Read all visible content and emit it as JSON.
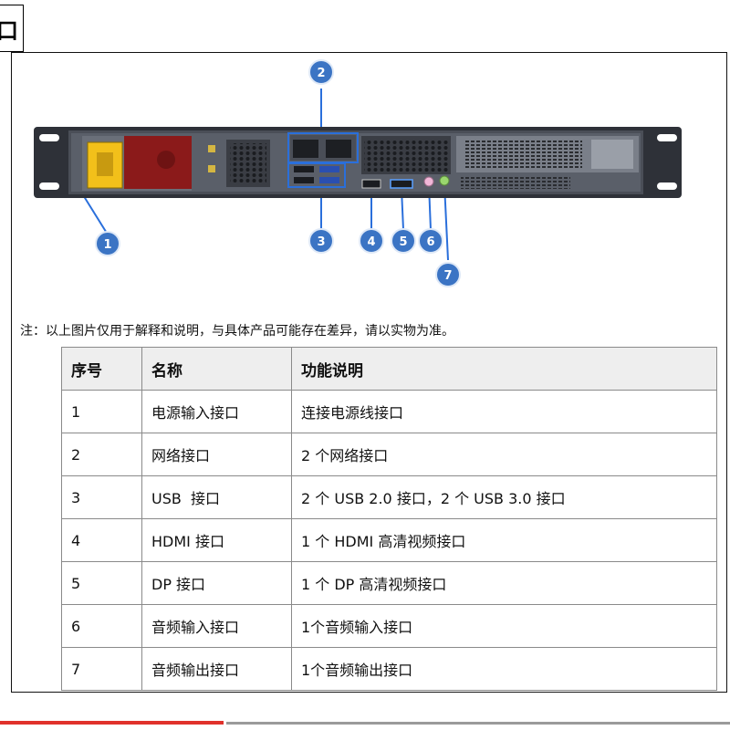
{
  "header": {
    "title_char": "口"
  },
  "figure": {
    "callouts": [
      "1",
      "2",
      "3",
      "4",
      "5",
      "6",
      "7"
    ],
    "colors": {
      "callout_fill": "#3b74c4",
      "power_socket": "#f2c01a",
      "power_module": "#8b1a1a",
      "highlight_box": "#2a6fdb",
      "chassis": "#4a4e57"
    }
  },
  "note": "注：以上图片仅用于解释和说明，与具体产品可能存在差异，请以实物为准。",
  "table": {
    "headers": [
      "序号",
      "名称",
      "功能说明"
    ],
    "rows": [
      [
        "1",
        "电源输入接口",
        "连接电源线接口"
      ],
      [
        "2",
        "网络接口",
        "2 个网络接口"
      ],
      [
        "3",
        "USB  接口",
        "2 个 USB 2.0 接口，2 个 USB 3.0 接口"
      ],
      [
        "4",
        "HDMI 接口",
        "1 个 HDMI 高清视频接口"
      ],
      [
        "5",
        "DP 接口",
        "1 个 DP 高清视频接口"
      ],
      [
        "6",
        "音频输入接口",
        "1个音频输入接口"
      ],
      [
        "7",
        "音频输出接口",
        "1个音频输出接口"
      ]
    ]
  }
}
